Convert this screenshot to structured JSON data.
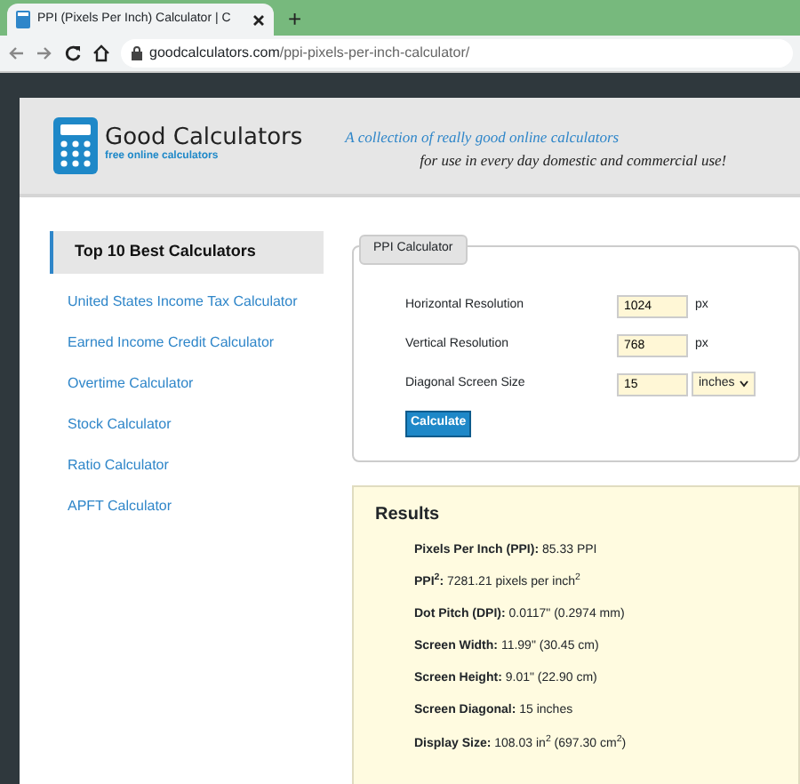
{
  "browser": {
    "tab_title": "PPI (Pixels Per Inch) Calculator | C",
    "new_tab": "+",
    "url_domain": "goodcalculators.com",
    "url_path": "/ppi-pixels-per-inch-calculator/"
  },
  "header": {
    "logo_title": "Good Calculators",
    "logo_subtitle": "free online calculators",
    "tagline_1": "A collection of really good online calculators",
    "tagline_2": "for use in every day domestic and commercial use!"
  },
  "sidebar": {
    "items": [
      {
        "label": "Top 10 Best Calculators",
        "selected": true
      },
      {
        "label": "United States Income Tax Calculator",
        "selected": false
      },
      {
        "label": "Earned Income Credit Calculator",
        "selected": false
      },
      {
        "label": "Overtime Calculator",
        "selected": false
      },
      {
        "label": "Stock Calculator",
        "selected": false
      },
      {
        "label": "Ratio Calculator",
        "selected": false
      },
      {
        "label": "APFT Calculator",
        "selected": false
      }
    ]
  },
  "calculator": {
    "title": "PPI Calculator",
    "fields": [
      {
        "label": "Horizontal Resolution",
        "value": "1024",
        "unit": "px",
        "kind": "text"
      },
      {
        "label": "Vertical Resolution",
        "value": "768",
        "unit": "px",
        "kind": "text"
      },
      {
        "label": "Diagonal Screen Size",
        "value": "15",
        "unit": "inches",
        "kind": "select"
      }
    ],
    "button": "Calculate"
  },
  "results": {
    "title": "Results",
    "lines": [
      "**Pixels Per Inch (PPI):** 85.33 PPI",
      "**PPI$^{2}$:** 7281.21 pixels per inch$^{2}$",
      "**Dot Pitch (DPI):** 0.0117\" (0.2974 mm)",
      "**Screen Width:** 11.99\" (30.45 cm)",
      "**Screen Height:** 9.01\" (22.90 cm)",
      "**Screen Diagonal:** 15 inches",
      "**Display Size:** 108.03 in$^{2}$ (697.30 cm$^{2}$)"
    ]
  }
}
